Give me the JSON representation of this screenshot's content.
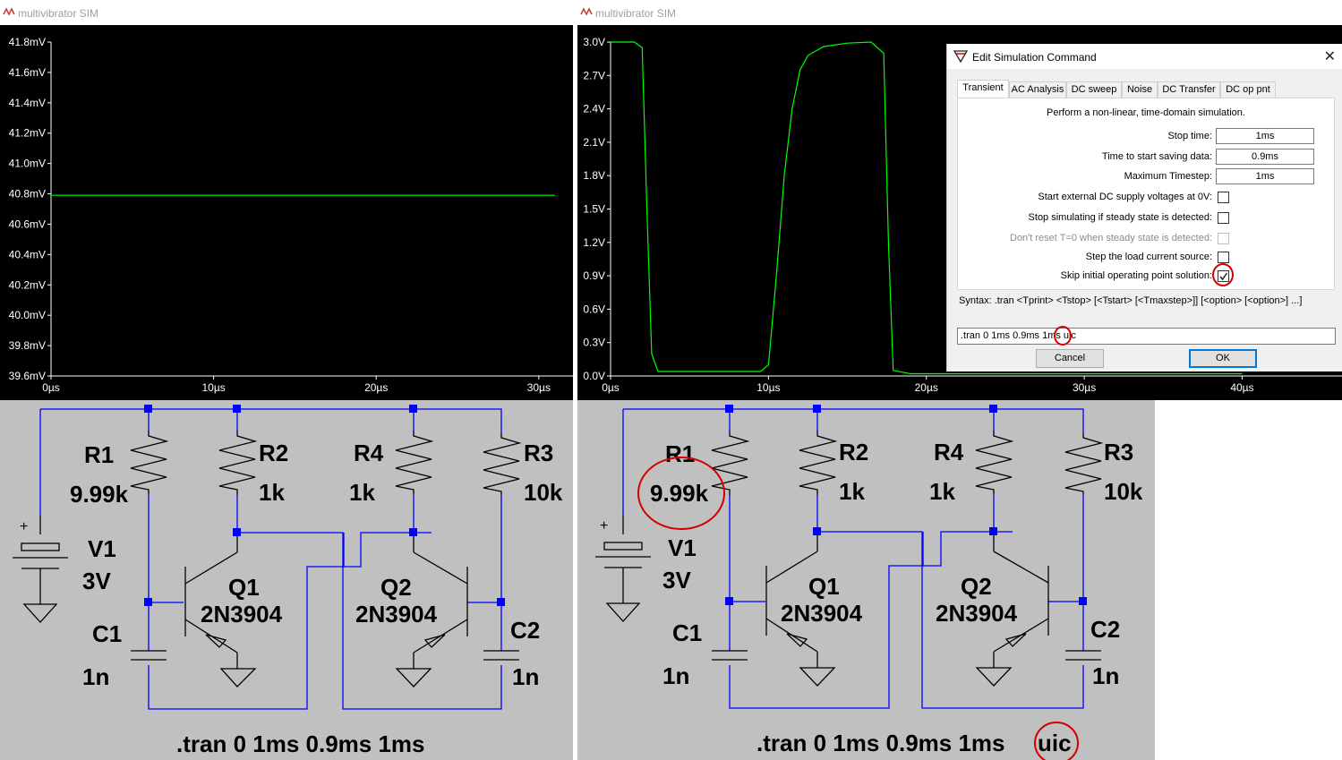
{
  "left_window": {
    "title": "multivibrator SIM",
    "y_ticks": [
      "41.8mV",
      "41.6mV",
      "41.4mV",
      "41.2mV",
      "41.0mV",
      "40.8mV",
      "40.6mV",
      "40.4mV",
      "40.2mV",
      "40.0mV",
      "39.8mV",
      "39.6mV"
    ],
    "x_ticks": [
      "0µs",
      "10µs",
      "20µs",
      "30µs"
    ]
  },
  "right_window": {
    "title": "multivibrator SIM",
    "y_ticks": [
      "3.0V",
      "2.7V",
      "2.4V",
      "2.1V",
      "1.8V",
      "1.5V",
      "1.2V",
      "0.9V",
      "0.6V",
      "0.3V",
      "0.0V"
    ],
    "x_ticks": [
      "0µs",
      "10µs",
      "20µs",
      "30µs",
      "40µs"
    ]
  },
  "chart_data": [
    {
      "type": "line",
      "x": [
        0,
        31
      ],
      "series": [
        {
          "values": [
            40.79,
            40.79
          ]
        }
      ],
      "xlim": [
        0,
        31
      ],
      "ylim": [
        39.6,
        41.8
      ],
      "color": "#00ff00"
    },
    {
      "type": "line",
      "x": [
        0,
        1.5,
        2.0,
        2.3,
        2.6,
        3.0,
        9.5,
        10.0,
        10.5,
        11.0,
        11.5,
        12.0,
        12.5,
        13.5,
        15.0,
        16.5,
        17.3,
        17.6,
        17.9,
        19.0,
        40.0
      ],
      "series": [
        {
          "values": [
            3.0,
            3.0,
            2.95,
            1.5,
            0.2,
            0.04,
            0.04,
            0.1,
            0.9,
            1.8,
            2.4,
            2.75,
            2.88,
            2.96,
            2.99,
            3.0,
            2.9,
            1.2,
            0.05,
            0.02,
            0.02
          ]
        }
      ],
      "xlim": [
        0,
        44
      ],
      "ylim": [
        0,
        3.0
      ],
      "color": "#00ff00"
    }
  ],
  "dialog": {
    "title": "Edit Simulation Command",
    "tabs": [
      "Transient",
      "AC Analysis",
      "DC sweep",
      "Noise",
      "DC Transfer",
      "DC op pnt"
    ],
    "description": "Perform a non-linear, time-domain simulation.",
    "stop_time_label": "Stop time:",
    "stop_time": "1ms",
    "start_saving_label": "Time to start saving data:",
    "start_saving": "0.9ms",
    "max_timestep_label": "Maximum Timestep:",
    "max_timestep": "1ms",
    "opt1": "Start external DC supply voltages at 0V:",
    "opt2": "Stop simulating if steady state is detected:",
    "opt3": "Don't reset T=0 when steady state is detected:",
    "opt4": "Step the load current source:",
    "opt5": "Skip initial operating point solution:",
    "syntax": "Syntax:  .tran <Tprint> <Tstop> [<Tstart> [<Tmaxstep>]] [<option> [<option>] ...]",
    "command": ".tran 0 1ms 0.9ms 1ms uic",
    "cancel": "Cancel",
    "ok": "OK"
  },
  "schematic_left": {
    "r1": "R1",
    "r1_val": "9.99k",
    "r2": "R2",
    "r2_val": "1k",
    "r4": "R4",
    "r4_val": "1k",
    "r3": "R3",
    "r3_val": "10k",
    "v1": "V1",
    "v1_val": "3V",
    "plus": "+",
    "q1": "Q1",
    "q1_model": "2N3904",
    "q2": "Q2",
    "q2_model": "2N3904",
    "c1": "C1",
    "c1_val": "1n",
    "c2": "C2",
    "c2_val": "1n",
    "directive": ".tran 0 1ms 0.9ms 1ms"
  },
  "schematic_right": {
    "r1": "R1",
    "r1_val": "9.99k",
    "r2": "R2",
    "r2_val": "1k",
    "r4": "R4",
    "r4_val": "1k",
    "r3": "R3",
    "r3_val": "10k",
    "v1": "V1",
    "v1_val": "3V",
    "plus": "+",
    "q1": "Q1",
    "q1_model": "2N3904",
    "q2": "Q2",
    "q2_model": "2N3904",
    "c1": "C1",
    "c1_val": "1n",
    "c2": "C2",
    "c2_val": "1n",
    "directive": ".tran 0 1ms 0.9ms 1ms",
    "directive_extra": "uic"
  },
  "colors": {
    "trace": "#00ff00",
    "wire": "#0000ff",
    "highlight": "#d40000",
    "schematic_bg": "#c0c0c0"
  }
}
